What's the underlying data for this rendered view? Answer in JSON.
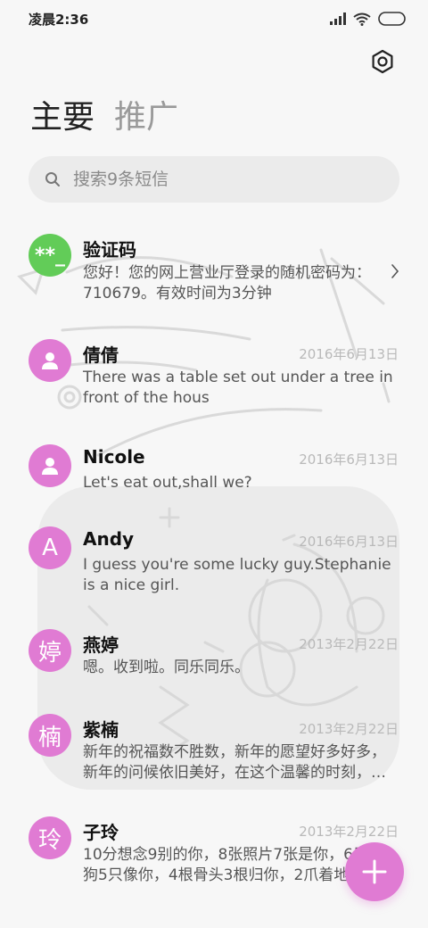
{
  "status_bar": {
    "time": "凌晨2:36"
  },
  "tabs": [
    {
      "label": "主要"
    },
    {
      "label": "推广"
    }
  ],
  "search": {
    "placeholder": "搜索9条短信"
  },
  "messages": [
    {
      "avatar_text": "**_",
      "avatar_color": "#62cc58",
      "name": "验证码",
      "date": "",
      "preview": "您好！您的网上营业厅登录的随机密码为：710679。有效时间为3分钟"
    },
    {
      "avatar_text": "",
      "avatar_color": "#e07bd3",
      "name": "倩倩",
      "date": "2016年6月13日",
      "preview": "There was a table set out under a tree in front of the hous"
    },
    {
      "avatar_text": "",
      "avatar_color": "#e07bd3",
      "name": "Nicole",
      "date": "2016年6月13日",
      "preview": "Let's eat out,shall we?"
    },
    {
      "avatar_text": "A",
      "avatar_color": "#e07bd3",
      "name": "Andy",
      "date": "2016年6月13日",
      "preview": "I guess you're some lucky guy.Stephanie is a nice girl."
    },
    {
      "avatar_text": "婷",
      "avatar_color": "#e07bd3",
      "name": "燕婷",
      "date": "2013年2月22日",
      "preview": "嗯。收到啦。同乐同乐。"
    },
    {
      "avatar_text": "楠",
      "avatar_color": "#e07bd3",
      "name": "紫楠",
      "date": "2013年2月22日",
      "preview": "新年的祝福数不胜数，新年的愿望好多好多，新年的问候依旧美好，在这个温馨的时刻，…"
    },
    {
      "avatar_text": "玲",
      "avatar_color": "#e07bd3",
      "name": "子玲",
      "date": "2013年2月22日",
      "preview": "10分想念9别的你，8张照片7张是你，6只小狗5只像你，4根骨头3根归你，2爪着地"
    }
  ],
  "icons": {
    "settings": "gear-icon",
    "search": "search-icon",
    "compose": "plus-icon",
    "person": "person-icon"
  }
}
